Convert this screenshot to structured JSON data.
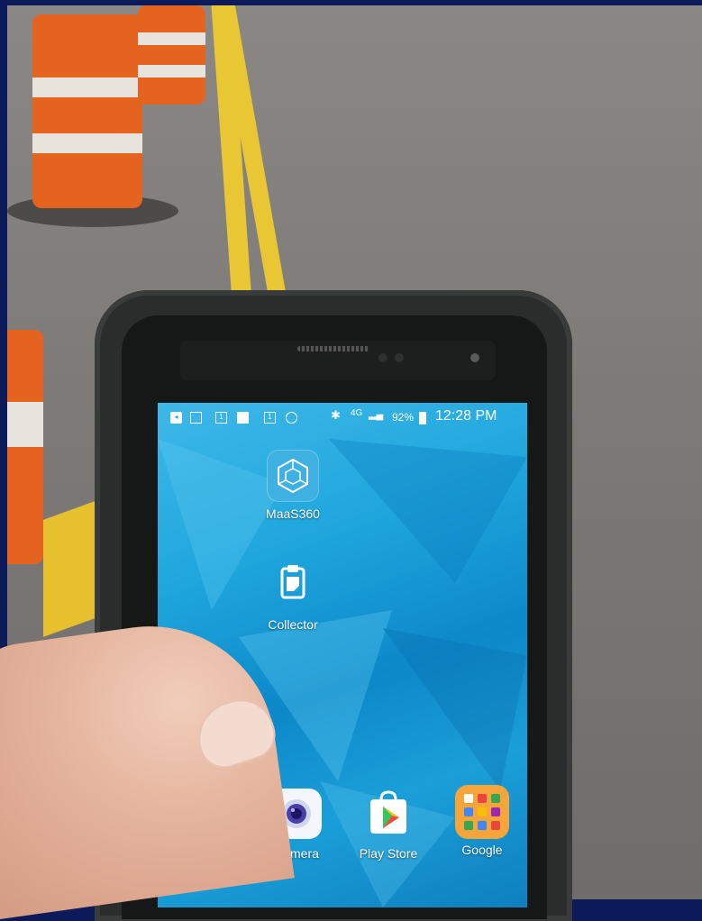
{
  "status_bar": {
    "battery": "92%",
    "time": "12:28 PM",
    "network": "4G"
  },
  "apps": [
    {
      "label": "MaaS360",
      "icon": "maas360-cube-icon"
    },
    {
      "label": "Collector",
      "icon": "clipboard-icon"
    }
  ],
  "dock": [
    {
      "label": "Camera",
      "icon": "camera-icon"
    },
    {
      "label": "Play Store",
      "icon": "play-store-icon"
    },
    {
      "label": "Google",
      "icon": "google-folder-icon"
    }
  ],
  "colors": {
    "wallpaper": "#1fa6dd",
    "road_line": "#e9c634",
    "barrel_orange": "#e4641f"
  }
}
